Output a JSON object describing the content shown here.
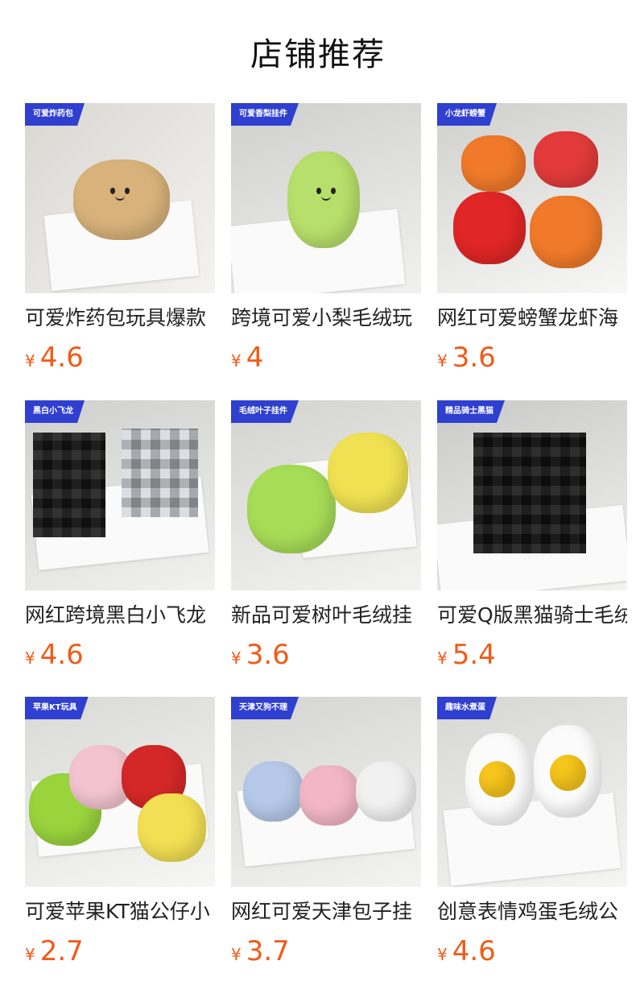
{
  "header": {
    "title": "店铺推荐"
  },
  "products": [
    {
      "tag": "可爱炸药包",
      "name": "可爱炸药包玩具爆款",
      "currency": "¥",
      "price": "4.6"
    },
    {
      "tag": "可爱香梨挂件",
      "name": "跨境可爱小梨毛绒玩",
      "currency": "¥",
      "price": "4"
    },
    {
      "tag": "小龙虾螃蟹",
      "name": "网红可爱螃蟹龙虾海",
      "currency": "¥",
      "price": "3.6"
    },
    {
      "tag": "黑白小飞龙",
      "name": "网红跨境黑白小飞龙",
      "currency": "¥",
      "price": "4.6"
    },
    {
      "tag": "毛绒叶子挂件",
      "name": "新品可爱树叶毛绒挂",
      "currency": "¥",
      "price": "3.6"
    },
    {
      "tag": "精品骑士黑猫",
      "name": "可爱Q版黑猫骑士毛绒",
      "currency": "¥",
      "price": "5.4"
    },
    {
      "tag": "苹果KT玩具",
      "name": "可爱苹果KT猫公仔小",
      "currency": "¥",
      "price": "2.7"
    },
    {
      "tag": "天津又狗不理",
      "name": "网红可爱天津包子挂",
      "currency": "¥",
      "price": "3.7"
    },
    {
      "tag": "趣味水煮蛋",
      "name": "创意表情鸡蛋毛绒公",
      "currency": "¥",
      "price": "4.6"
    }
  ],
  "colors": {
    "price": "#f25a16",
    "tag_bg": "#2f3fcf"
  }
}
